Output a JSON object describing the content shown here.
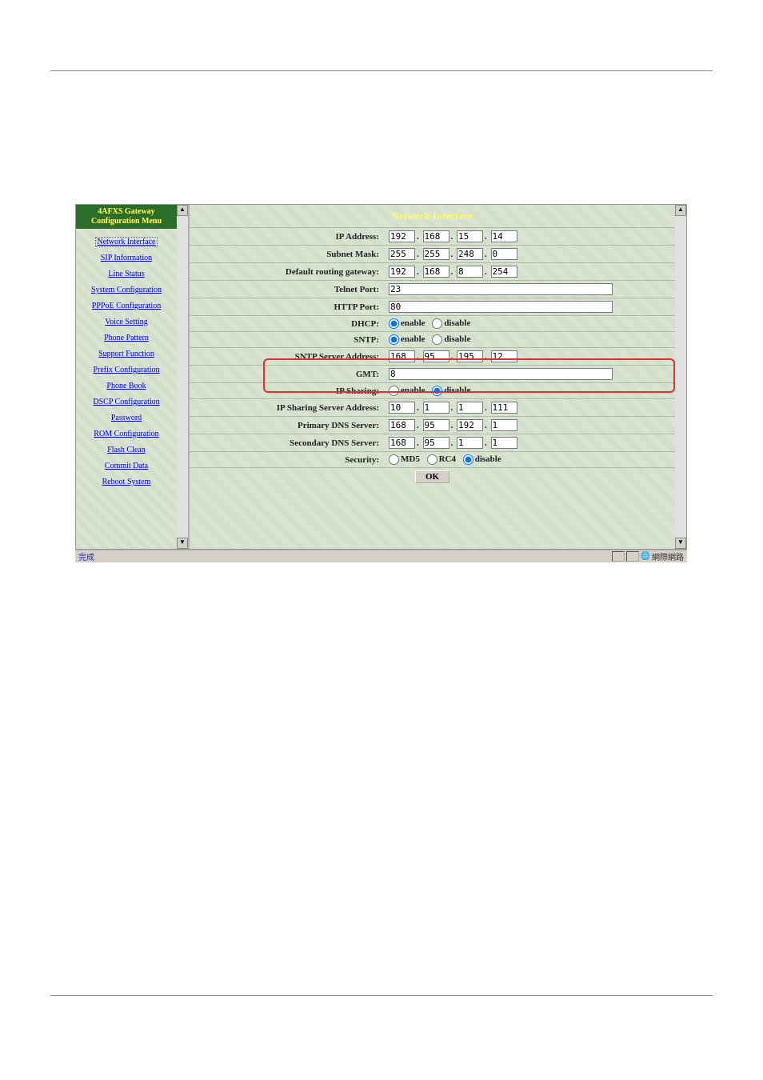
{
  "sidebar": {
    "title_line1": "4AFXS Gateway",
    "title_line2": "Configuration Menu",
    "items": [
      {
        "label": "Network Interface",
        "active": true
      },
      {
        "label": "SIP Information"
      },
      {
        "label": "Line Status"
      },
      {
        "label": "System Configuration"
      },
      {
        "label": "PPPoE Configuration"
      },
      {
        "label": "Voice Setting"
      },
      {
        "label": "Phone Pattern"
      },
      {
        "label": "Support Function"
      },
      {
        "label": "Prefix Configuration"
      },
      {
        "label": "Phone Book"
      },
      {
        "label": "DSCP Configuration"
      },
      {
        "label": "Password"
      },
      {
        "label": "ROM Configuration"
      },
      {
        "label": "Flash Clean"
      },
      {
        "label": "Commit Data"
      },
      {
        "label": "Reboot System"
      }
    ]
  },
  "main": {
    "title": "Network Interface",
    "rows": {
      "ip_address": {
        "label": "IP Address:",
        "octets": [
          "192",
          "168",
          "15",
          "14"
        ]
      },
      "subnet_mask": {
        "label": "Subnet Mask:",
        "octets": [
          "255",
          "255",
          "248",
          "0"
        ]
      },
      "gateway": {
        "label": "Default routing gateway:",
        "octets": [
          "192",
          "168",
          "8",
          "254"
        ]
      },
      "telnet_port": {
        "label": "Telnet Port:",
        "value": "23"
      },
      "http_port": {
        "label": "HTTP Port:",
        "value": "80"
      },
      "dhcp": {
        "label": "DHCP:",
        "enable": "enable",
        "disable": "disable",
        "selected": "enable"
      },
      "sntp": {
        "label": "SNTP:",
        "enable": "enable",
        "disable": "disable",
        "selected": "enable"
      },
      "sntp_server": {
        "label": "SNTP Server Address:",
        "octets": [
          "168",
          "95",
          "195",
          "12"
        ]
      },
      "gmt": {
        "label": "GMT:",
        "value": "8"
      },
      "ip_sharing": {
        "label": "IP Sharing:",
        "enable": "enable",
        "disable": "disable",
        "selected": "disable"
      },
      "ip_sharing_server": {
        "label": "IP Sharing Server Address:",
        "octets": [
          "10",
          "1",
          "1",
          "111"
        ]
      },
      "primary_dns": {
        "label": "Primary DNS Server:",
        "octets": [
          "168",
          "95",
          "192",
          "1"
        ]
      },
      "secondary_dns": {
        "label": "Secondary DNS Server:",
        "octets": [
          "168",
          "95",
          "1",
          "1"
        ]
      },
      "security": {
        "label": "Security:",
        "md5": "MD5",
        "rc4": "RC4",
        "disable": "disable",
        "selected": "disable"
      }
    },
    "ok_label": "OK"
  },
  "statusbar": {
    "left": "完成",
    "right": "網際網路"
  }
}
